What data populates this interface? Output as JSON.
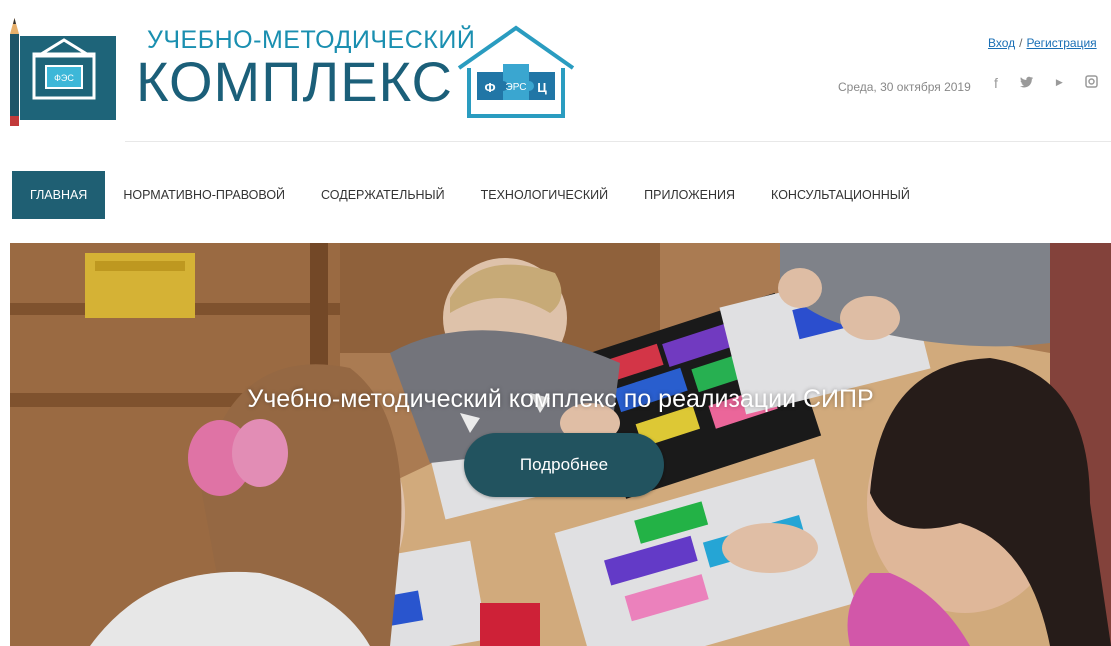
{
  "header": {
    "logo_line1": "УЧЕБНО-МЕТОДИЧЕСКИЙ",
    "logo_line2": "КОМПЛЕКС",
    "logo_icon": "house-puzzle-icon",
    "fgos_letters": [
      "Ф",
      "ЭРС",
      "Ц"
    ],
    "auth": {
      "login": "Вход",
      "separator": "/",
      "register": "Регистрация"
    },
    "date": "Среда, 30 октября 2019",
    "social": [
      {
        "name": "facebook-icon",
        "glyph": "f"
      },
      {
        "name": "twitter-icon",
        "glyph": "🐦"
      },
      {
        "name": "youtube-icon",
        "glyph": "▶"
      },
      {
        "name": "instagram-icon",
        "glyph": "▣"
      }
    ]
  },
  "nav": {
    "items": [
      {
        "label": "ГЛАВНАЯ",
        "active": true
      },
      {
        "label": "НОРМАТИВНО-ПРАВОВОЙ",
        "active": false
      },
      {
        "label": "СОДЕРЖАТЕЛЬНЫЙ",
        "active": false
      },
      {
        "label": "ТЕХНОЛОГИЧЕСКИЙ",
        "active": false
      },
      {
        "label": "ПРИЛОЖЕНИЯ",
        "active": false
      },
      {
        "label": "КОНСУЛЬТАЦИОННЫЙ",
        "active": false
      }
    ]
  },
  "hero": {
    "title": "Учебно-методический комплекс по реализации СИПР",
    "button": "Подробнее"
  },
  "colors": {
    "brand_dark": "#1f5f73",
    "brand_light": "#1a8fb0",
    "button": "#22535f",
    "link": "#1a6fb5"
  }
}
